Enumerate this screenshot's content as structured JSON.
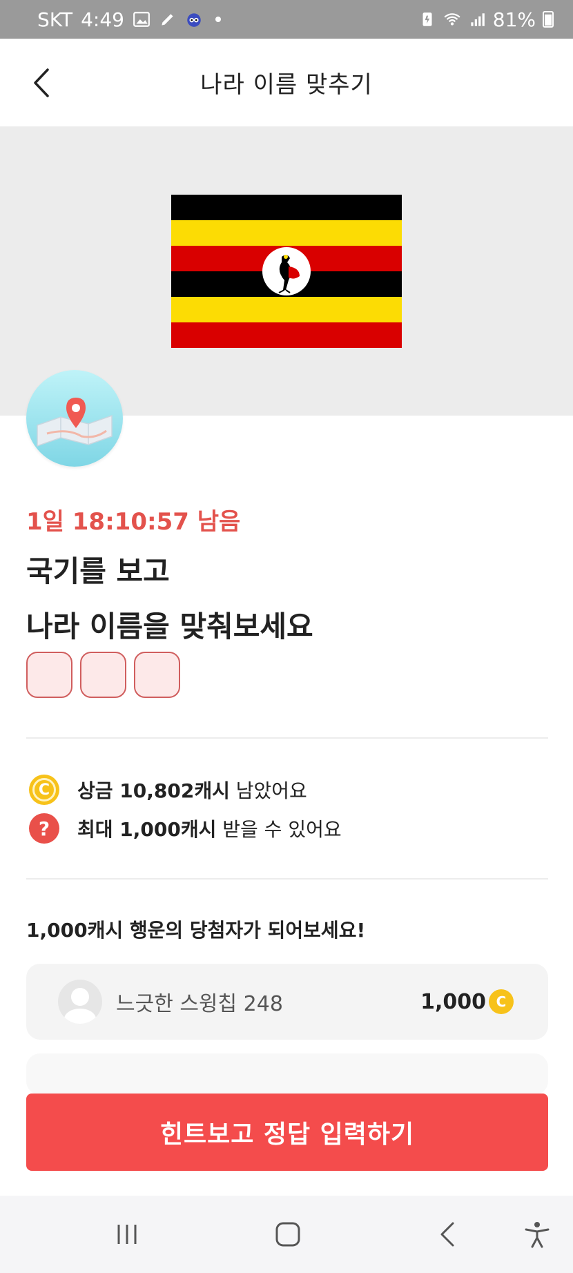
{
  "status_bar": {
    "carrier": "SKT",
    "time": "4:49",
    "battery_percent": "81%"
  },
  "header": {
    "title": "나라 이름 맞추기"
  },
  "quiz": {
    "timer": "1일 18:10:57 남음",
    "title_line1": "국기를 보고",
    "title_line2": "나라 이름을 맞춰보세요",
    "answer_box_count": 3
  },
  "info": {
    "prize_prefix": "상금 10,802캐시",
    "prize_suffix": " 남았어요",
    "max_prefix": "최대 1,000캐시",
    "max_suffix": " 받을 수 있어요"
  },
  "winners": {
    "title": "1,000캐시 행운의 당첨자가 되어보세요!",
    "items": [
      {
        "name": "느긋한 스윙칩 248",
        "prize": "1,000"
      }
    ]
  },
  "cta": {
    "label": "힌트보고 정답 입력하기"
  },
  "colors": {
    "accent": "#f44c4c",
    "timer": "#e3524c",
    "coin": "#f7c21a"
  },
  "icons": {
    "back": "chevron-left-icon",
    "coin": "coin-icon",
    "help": "question-icon",
    "map": "map-pin-icon"
  }
}
